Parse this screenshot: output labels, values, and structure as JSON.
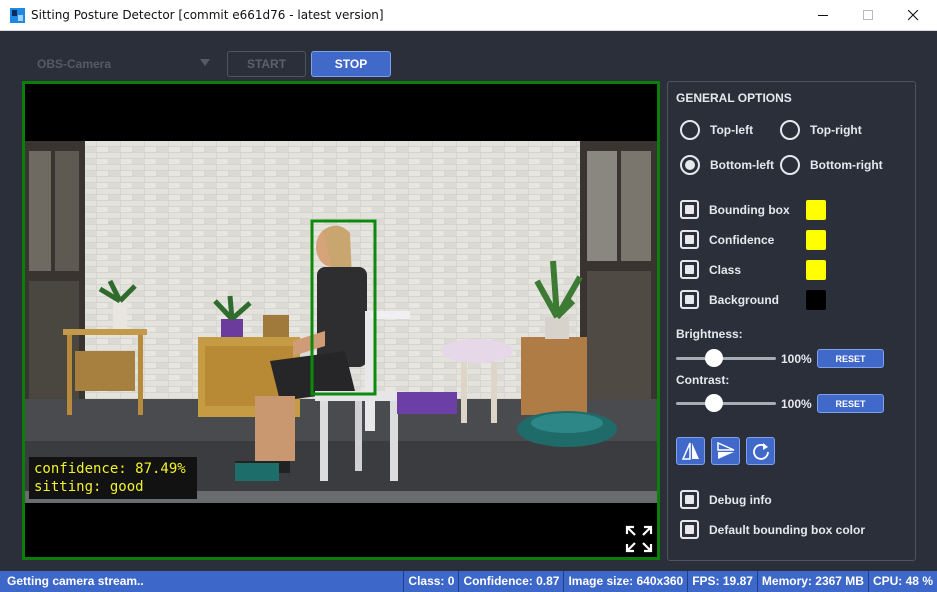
{
  "window": {
    "title": "Sitting Posture Detector [commit e661d76 - latest version]"
  },
  "toolbar": {
    "camera_selected": "OBS-Camera",
    "start_label": "START",
    "stop_label": "STOP"
  },
  "video": {
    "overlay_confidence": "confidence: 87.49%",
    "overlay_sitting": "sitting: good"
  },
  "options": {
    "title": "GENERAL OPTIONS",
    "positions": [
      {
        "label": "Top-left",
        "checked": false
      },
      {
        "label": "Top-right",
        "checked": false
      },
      {
        "label": "Bottom-left",
        "checked": true
      },
      {
        "label": "Bottom-right",
        "checked": false
      }
    ],
    "checkboxes": [
      {
        "label": "Bounding box",
        "color": "#ffff00"
      },
      {
        "label": "Confidence",
        "color": "#ffff00"
      },
      {
        "label": "Class",
        "color": "#ffff00"
      },
      {
        "label": "Background",
        "color": "#000000"
      }
    ],
    "brightness": {
      "label": "Brightness:",
      "value": "100%",
      "reset": "RESET",
      "level": 0.37
    },
    "contrast": {
      "label": "Contrast:",
      "value": "100%",
      "reset": "RESET",
      "level": 0.37
    },
    "debug_label": "Debug info",
    "default_bbox_label": "Default bounding box color"
  },
  "status": {
    "message": "Getting camera stream..",
    "class": "Class: 0",
    "confidence": "Confidence: 0.87",
    "image_size": "Image size: 640x360",
    "fps": "FPS: 19.87",
    "memory": "Memory: 2367 MB",
    "cpu": "CPU: 48 %"
  },
  "colors": {
    "accent": "#4169c9",
    "bbox": "#0b7d0b",
    "overlay_text": "#f2f22a"
  }
}
